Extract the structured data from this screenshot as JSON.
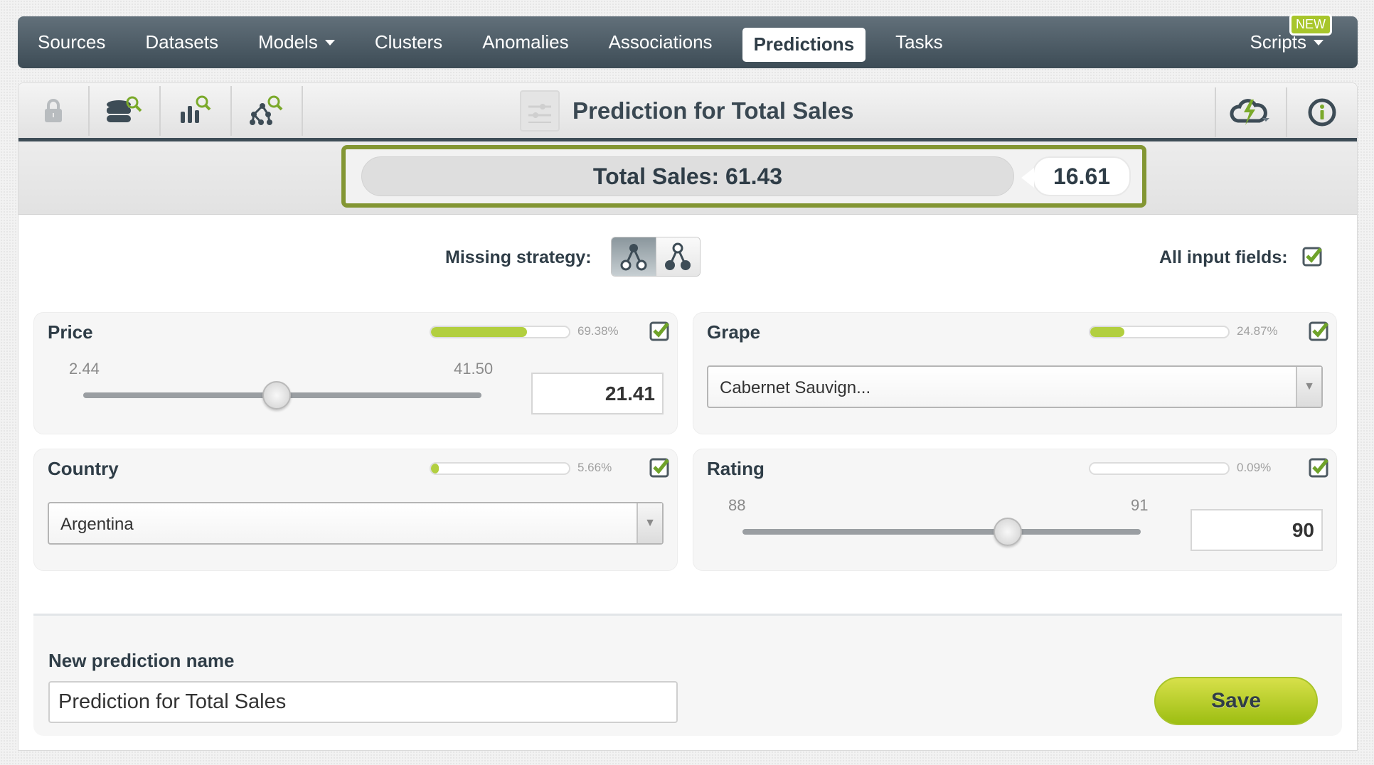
{
  "nav": {
    "items": [
      {
        "label": "Sources",
        "has_caret": false,
        "active": false
      },
      {
        "label": "Datasets",
        "has_caret": false,
        "active": false
      },
      {
        "label": "Models",
        "has_caret": true,
        "active": false
      },
      {
        "label": "Clusters",
        "has_caret": false,
        "active": false
      },
      {
        "label": "Anomalies",
        "has_caret": false,
        "active": false
      },
      {
        "label": "Associations",
        "has_caret": false,
        "active": false
      },
      {
        "label": "Predictions",
        "has_caret": false,
        "active": true
      },
      {
        "label": "Tasks",
        "has_caret": false,
        "active": false
      }
    ],
    "scripts_label": "Scripts",
    "new_badge": "NEW"
  },
  "toolbar": {
    "title": "Prediction for Total Sales",
    "left_icons": [
      "lock-icon",
      "dataset-search-icon",
      "model-bars-search-icon",
      "tree-search-icon"
    ],
    "right_icons": [
      "cloud-lightning-icon",
      "info-icon"
    ]
  },
  "result": {
    "label": "Total Sales: 61.43",
    "confidence": "16.61"
  },
  "controls": {
    "missing_strategy_label": "Missing strategy:",
    "missing_strategy_options": [
      "last-prediction",
      "proportional"
    ],
    "missing_strategy_selected": "last-prediction",
    "all_input_fields_label": "All input fields:",
    "all_input_fields_checked": true
  },
  "fields": [
    {
      "name": "Price",
      "type": "numeric",
      "importance": 69.38,
      "importance_label": "69.38%",
      "min": "2.44",
      "max": "41.50",
      "min_value": 2.44,
      "max_value": 41.5,
      "value": "21.41",
      "checked": true
    },
    {
      "name": "Grape",
      "type": "categorical",
      "importance": 24.87,
      "importance_label": "24.87%",
      "value": "Cabernet Sauvign...",
      "checked": true
    },
    {
      "name": "Country",
      "type": "categorical",
      "importance": 5.66,
      "importance_label": "5.66%",
      "value": "Argentina",
      "checked": true
    },
    {
      "name": "Rating",
      "type": "numeric",
      "importance": 0.09,
      "importance_label": "0.09%",
      "min": "88",
      "max": "91",
      "min_value": 88,
      "max_value": 91,
      "value": "90",
      "checked": true
    }
  ],
  "footer": {
    "name_label": "New prediction name",
    "name_value": "Prediction for Total Sales",
    "save_label": "Save"
  },
  "colors": {
    "accent_green": "#b2cf3f",
    "result_border": "#839633",
    "nav_dark": "#3d4c56"
  }
}
